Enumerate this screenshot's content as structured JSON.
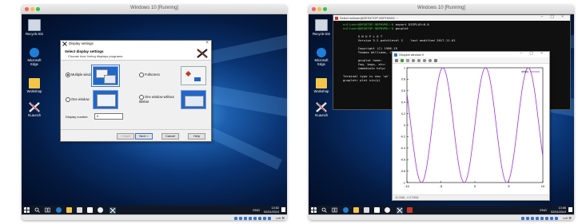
{
  "left_vm": {
    "window_title": "Windows 10 [Running]",
    "desktop_icons": [
      {
        "label": "Recycle Bin",
        "icon": "recycle-bin-icon"
      },
      {
        "label": "Microsoft Edge",
        "icon": "edge-icon"
      },
      {
        "label": "Workshop",
        "icon": "folder-icon"
      },
      {
        "label": "XLaunch",
        "icon": "xlaunch-icon"
      }
    ],
    "dialog": {
      "title": "Display settings",
      "heading": "Select display settings",
      "subheading": "Choose how Xming displays programs.",
      "options": [
        {
          "label": "Multiple windows",
          "selected": true
        },
        {
          "label": "Fullscreen",
          "selected": false
        },
        {
          "label": "One window",
          "selected": false
        },
        {
          "label": "One window without titlebar",
          "selected": false
        }
      ],
      "display_number_label": "Display number",
      "display_number_value": "0",
      "buttons": {
        "back": "< Back",
        "next": "Next >",
        "cancel": "Cancel",
        "help": "Help"
      }
    },
    "clock": {
      "time": "13:52",
      "date": "02/01/2019"
    },
    "ime": "ENG",
    "status_hint": "Left ⌘"
  },
  "right_vm": {
    "window_title": "Windows 10 [Running]",
    "desktop_icons": [
      {
        "label": "Recycle Bin",
        "icon": "recycle-bin-icon"
      },
      {
        "label": "Microsoft Edge",
        "icon": "edge-icon"
      },
      {
        "label": "Workshop",
        "icon": "folder-icon"
      },
      {
        "label": "XLaunch",
        "icon": "xlaunch-icon"
      }
    ],
    "terminal": {
      "title": "Select nulluser@DESKTOP-9DPHVMG: ~",
      "lines": [
        {
          "prompt": "nulluser@DESKTOP-9DPHVMG:~$",
          "text": " export DISPLAY=0.0"
        },
        {
          "prompt": "nulluser@DESKTOP-9DPHVMG:~$",
          "text": " gnuplot"
        },
        {
          "prompt": "",
          "text": ""
        },
        {
          "prompt": "",
          "text": "        G N U P L O T"
        },
        {
          "prompt": "",
          "text": "        Version 5.2 patchlevel 2    last modified 2017-11-01"
        },
        {
          "prompt": "",
          "text": ""
        },
        {
          "prompt": "",
          "text": "        Copyright (C) 1986-19"
        },
        {
          "prompt": "",
          "text": "        Thomas Williams, Coli"
        },
        {
          "prompt": "",
          "text": ""
        },
        {
          "prompt": "",
          "text": "        gnuplot home:     htt"
        },
        {
          "prompt": "",
          "text": "        faq, bugs, etc:   typ"
        },
        {
          "prompt": "",
          "text": "        immediate help:   typ"
        },
        {
          "prompt": "",
          "text": ""
        },
        {
          "prompt": "",
          "text": "Terminal type is now 'qt'"
        },
        {
          "prompt": "",
          "text": "gnuplot> plot sin(x)"
        }
      ]
    },
    "gnuplot": {
      "title": "Gnuplot window 0",
      "status": "-10.3066, -0.072654",
      "legend": "sin(x)"
    },
    "clock": {
      "time": "13:56",
      "date": "02/01/2019"
    },
    "ime": "ENG",
    "status_hint": "Left ⌘"
  },
  "chart_data": {
    "type": "line",
    "series": [
      {
        "name": "sin(x)",
        "function": "sin(x)"
      }
    ],
    "xlim": [
      -10,
      10
    ],
    "ylim": [
      -1,
      1
    ],
    "xticks": [
      "-10",
      "-5",
      "0",
      "5",
      "10"
    ],
    "yticks": [
      "-1",
      "-0.8",
      "-0.6",
      "-0.4",
      "-0.2",
      "0",
      "0.2",
      "0.4",
      "0.6",
      "0.8",
      "1"
    ],
    "grid": false,
    "legend_position": "top-right",
    "line_color": "#9b30d9"
  },
  "colors": {
    "accent": "#3a73c9",
    "taskbar": "#101826",
    "terminal_bg": "#101010",
    "prompt_green": "#44d244"
  }
}
